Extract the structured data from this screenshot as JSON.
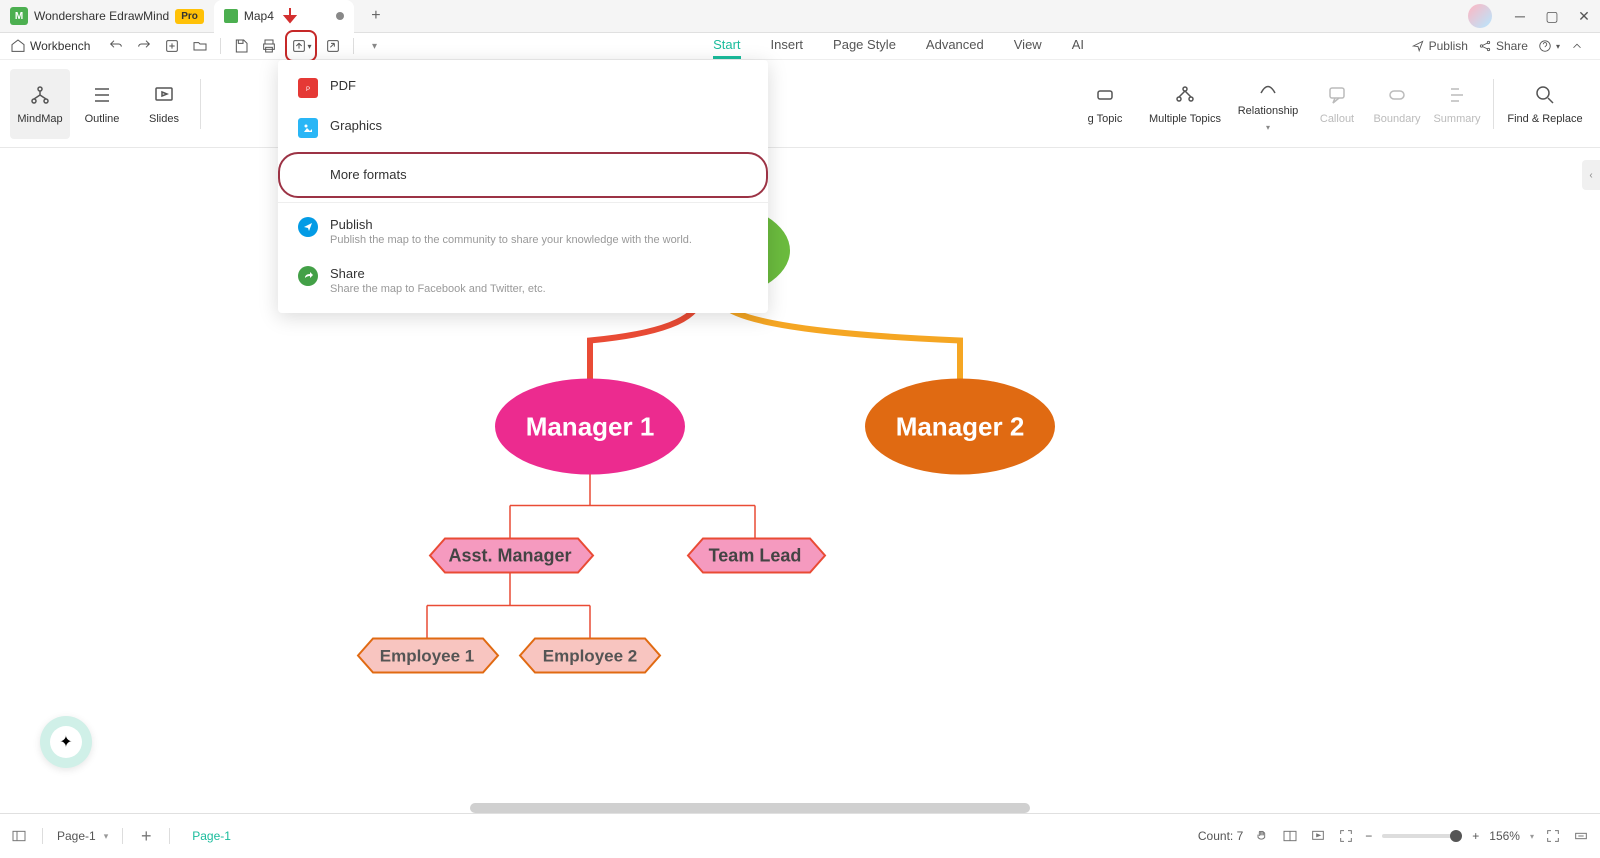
{
  "title_bar": {
    "app_name": "Wondershare EdrawMind",
    "pro_badge": "Pro",
    "doc_name": "Map4"
  },
  "toolbar": {
    "workbench": "Workbench",
    "tabs": [
      "Start",
      "Insert",
      "Page Style",
      "Advanced",
      "View",
      "AI"
    ],
    "active_tab": "Start",
    "publish": "Publish",
    "share": "Share"
  },
  "ribbon": {
    "mindmap": "MindMap",
    "outline": "Outline",
    "slides": "Slides",
    "topic_partial": "g Topic",
    "multiple_topics": "Multiple Topics",
    "relationship": "Relationship",
    "callout": "Callout",
    "boundary": "Boundary",
    "summary": "Summary",
    "find_replace": "Find & Replace"
  },
  "dropdown": {
    "pdf": "PDF",
    "graphics": "Graphics",
    "more_formats": "More formats",
    "publish": "Publish",
    "publish_sub": "Publish the map to the community to share your knowledge with the world.",
    "share": "Share",
    "share_sub": "Share the map to Facebook and Twitter, etc."
  },
  "nodes": {
    "manager1": "Manager 1",
    "manager2": "Manager 2",
    "asst_manager": "Asst. Manager",
    "team_lead": "Team Lead",
    "employee1": "Employee 1",
    "employee2": "Employee 2"
  },
  "status": {
    "page_label": "Page-1",
    "page_tab": "Page-1",
    "count_label": "Count: 7",
    "zoom": "156%"
  }
}
